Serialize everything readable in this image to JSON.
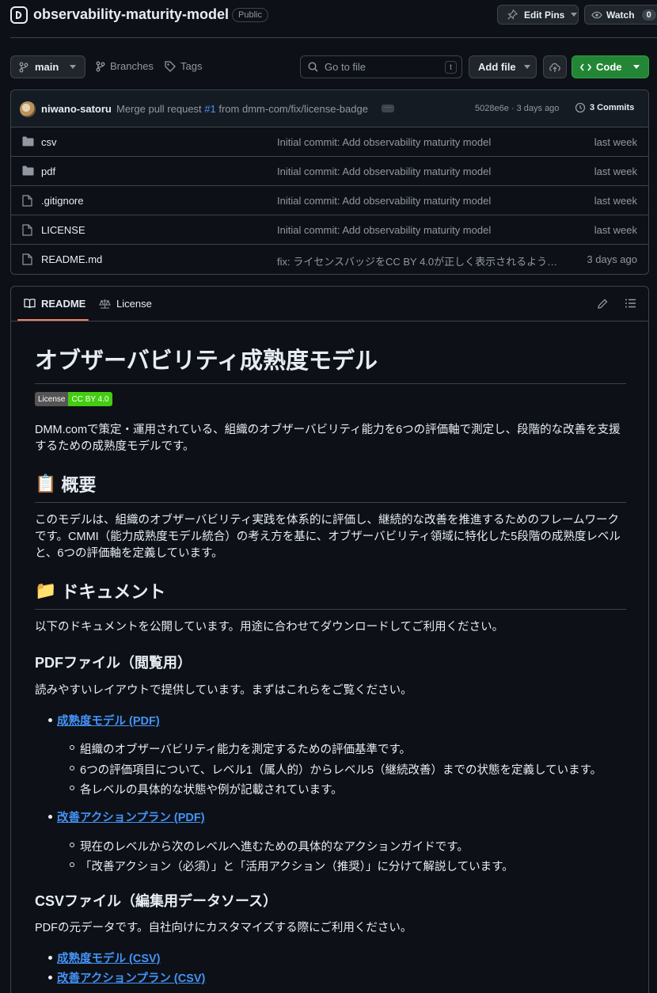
{
  "repo": {
    "name": "observability-maturity-model",
    "visibility": "Public"
  },
  "header_actions": {
    "edit_pins": "Edit Pins",
    "watch": "Watch",
    "watch_count": "0"
  },
  "toolbar": {
    "branch": "main",
    "branches": "Branches",
    "tags": "Tags",
    "search_placeholder": "Go to file",
    "search_key": "t",
    "add_file": "Add file",
    "code": "Code"
  },
  "commit": {
    "author": "niwano-satoru",
    "message_prefix": "Merge pull request ",
    "pr": "#1",
    "message_suffix": " from dmm-com/fix/license-badge",
    "sha_date": "5028e6e · 3 days ago",
    "commits": "3 Commits"
  },
  "files": [
    {
      "icon": "folder-icon",
      "name": "csv",
      "message": "Initial commit: Add observability maturity model",
      "date": "last week"
    },
    {
      "icon": "folder-icon",
      "name": "pdf",
      "message": "Initial commit: Add observability maturity model",
      "date": "last week"
    },
    {
      "icon": "file-icon",
      "name": ".gitignore",
      "message": "Initial commit: Add observability maturity model",
      "date": "last week"
    },
    {
      "icon": "file-icon",
      "name": "LICENSE",
      "message": "Initial commit: Add observability maturity model",
      "date": "last week"
    },
    {
      "icon": "file-icon",
      "name": "README.md",
      "message": "fix: ライセンスバッジをCC BY 4.0が正しく表示されるよう…",
      "date": "3 days ago"
    }
  ],
  "readme_tabs": {
    "readme": "README",
    "license": "License"
  },
  "readme": {
    "title": "オブザーバビリティ成熟度モデル",
    "badge_left": "License",
    "badge_right": "CC BY 4.0",
    "intro": "DMM.comで策定・運用されている、組織のオブザーバビリティ能力を6つの評価軸で測定し、段階的な改善を支援するための成熟度モデルです。",
    "overview_emoji": "📋",
    "overview_heading": "概要",
    "overview_text": "このモデルは、組織のオブザーバビリティ実践を体系的に評価し、継続的な改善を推進するためのフレームワークです。CMMI（能力成熟度モデル統合）の考え方を基に、オブザーバビリティ領域に特化した5段階の成熟度レベルと、6つの評価軸を定義しています。",
    "docs_emoji": "📁",
    "docs_heading": "ドキュメント",
    "docs_text": "以下のドキュメントを公開しています。用途に合わせてダウンロードしてご利用ください。",
    "pdf_heading": "PDFファイル（閲覧用）",
    "pdf_text": "読みやすいレイアウトで提供しています。まずはこれらをご覧ください。",
    "pdf_link1": "成熟度モデル (PDF)",
    "pdf_link1_items": [
      "組織のオブザーバビリティ能力を測定するための評価基準です。",
      "6つの評価項目について、レベル1（属人的）からレベル5（継続改善）までの状態を定義しています。",
      "各レベルの具体的な状態や例が記載されています。"
    ],
    "pdf_link2": "改善アクションプラン (PDF)",
    "pdf_link2_items": [
      "現在のレベルから次のレベルへ進むための具体的なアクションガイドです。",
      "「改善アクション（必須）」と「活用アクション（推奨）」に分けて解説しています。"
    ],
    "csv_heading": "CSVファイル（編集用データソース）",
    "csv_text": "PDFの元データです。自社向けにカスタマイズする際にご利用ください。",
    "csv_link1": "成熟度モデル (CSV)",
    "csv_link2": "改善アクションプラン (CSV)"
  }
}
